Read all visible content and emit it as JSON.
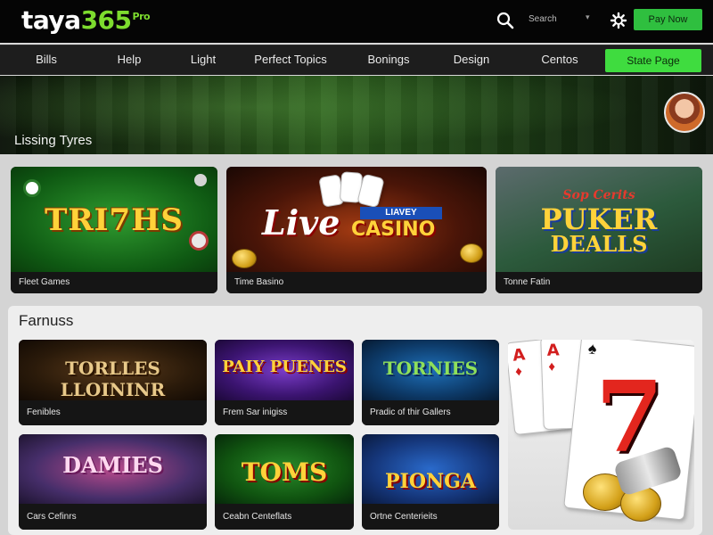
{
  "brand": {
    "part1": "taya",
    "part2": "365",
    "part3": "Pro"
  },
  "header": {
    "search_label": "Search",
    "pay_button": "Pay Now"
  },
  "nav": {
    "items": [
      "Bills",
      "Help",
      "Light",
      "Perfect Topics",
      "Bonings",
      "Design",
      "Centos"
    ],
    "state_button": "State Page"
  },
  "hero": {
    "title": "Lissing Tyres"
  },
  "top_cards": [
    {
      "title": "TRI7HS",
      "caption": "Fleet Games"
    },
    {
      "title_script": "Live",
      "title_banner": "LIAVEY",
      "title_main": "CASINO",
      "caption": "Time Basino"
    },
    {
      "title_script": "Sop Cerits",
      "title_main": "PUKER",
      "title_sub": "DEALLS",
      "caption": "Tonne Fatin"
    }
  ],
  "section": {
    "title": "Farnuss",
    "cards": [
      {
        "title": "TORLLES LLOININR",
        "caption": "Fenibles"
      },
      {
        "title": "PAIY PUENES",
        "caption": "Frem Sar inigiss"
      },
      {
        "title": "TORNIES",
        "caption": "Pradic of thir Gallers"
      },
      {
        "title": "DAMIES",
        "caption": "Cars Cefinrs"
      },
      {
        "title": "TOMS",
        "caption": "Ceabn Centeflats"
      },
      {
        "title": "PIONGA",
        "caption": "Ortne Centerieits"
      }
    ],
    "tall_card": {
      "rank": "A",
      "seven": "7"
    }
  }
}
